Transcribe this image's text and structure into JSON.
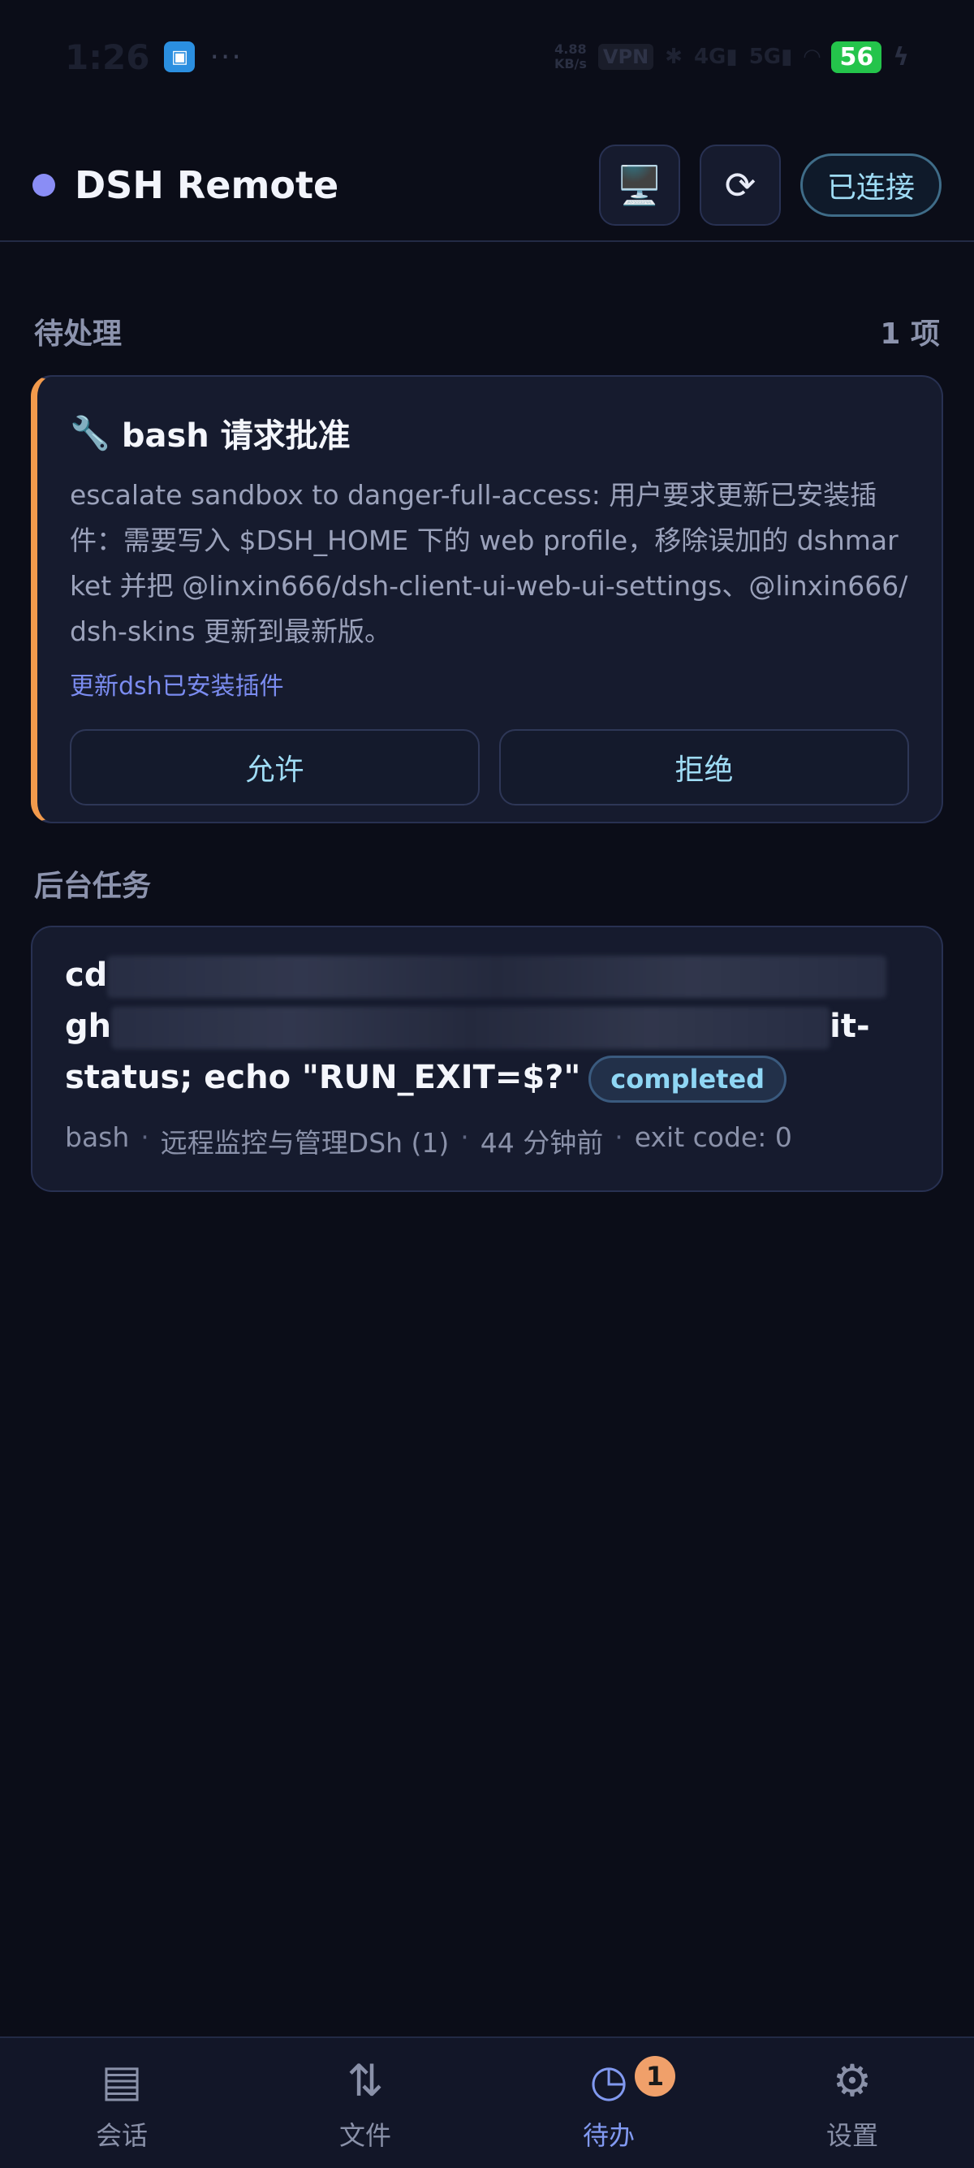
{
  "status_bar": {
    "time": "1:26",
    "speed_top": "4.88",
    "speed_bottom": "KB/s",
    "vpn": "VPN",
    "network_1": "4G",
    "network_2": "5G",
    "battery": "56"
  },
  "header": {
    "title": "DSH Remote",
    "screen_icon": "🖥️",
    "refresh_icon": "⟳",
    "connection_label": "已连接"
  },
  "pending": {
    "label": "待处理",
    "count": "1 项",
    "card": {
      "icon": "🔧",
      "title": "bash 请求批准",
      "description": "escalate sandbox to danger-full-access: 用户要求更新已安装插件：需要写入 $DSH_HOME 下的 web profile，移除误加的 dshmarket 并把 @linxin666/dsh-client-ui-web-ui-settings、@linxin666/dsh-skins 更新到最新版。",
      "link": "更新dsh已安装插件",
      "allow_label": "允许",
      "reject_label": "拒绝"
    }
  },
  "tasks": {
    "label": "后台任务",
    "card": {
      "cmd_line1_start": "cd",
      "cmd_line2_start": "gh",
      "cmd_line2_end": "it-",
      "cmd_line3": "status; echo \"RUN_EXIT=$?\"",
      "status_badge": "completed",
      "meta_tool": "bash",
      "meta_sep": "·",
      "meta_project": "远程监控与管理DSh (1)",
      "meta_time": "44 分钟前",
      "meta_exit": "exit code: 0"
    }
  },
  "nav": {
    "items": [
      {
        "label": "会话",
        "icon": "▤"
      },
      {
        "label": "文件",
        "icon": "⇅"
      },
      {
        "label": "待办",
        "icon": "◷",
        "badge": "1"
      },
      {
        "label": "设置",
        "icon": "⚙"
      }
    ]
  },
  "colors": {
    "background": "#0b0d18",
    "accent": "#8199f0",
    "warning_border": "#f29a4c",
    "badge": "#f0a06a"
  }
}
